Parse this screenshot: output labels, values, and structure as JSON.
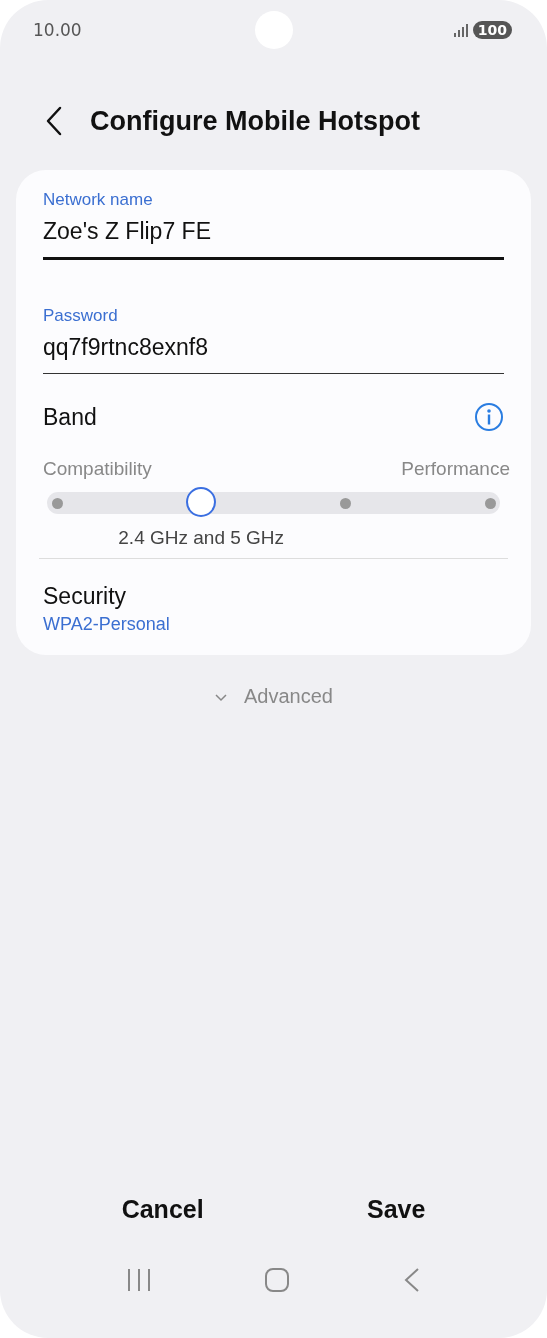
{
  "status_bar": {
    "time": "10.00",
    "battery": "100"
  },
  "header": {
    "title": "Configure Mobile Hotspot"
  },
  "fields": [
    {
      "label": "Network name",
      "value": "Zoe's Z Flip7 FE",
      "focused": true
    },
    {
      "label": "Password",
      "value": "qq7f9rtnc8exnf8",
      "focused": false
    }
  ],
  "band": {
    "label": "Band",
    "min_label": "Compatibility",
    "max_label": "Performance",
    "level": 0.333,
    "reading": "2.4 GHz and 5 GHz"
  },
  "security": {
    "label": "Security",
    "value": "WPA2-Personal"
  },
  "advanced": {
    "label": "Advanced",
    "expanded": false
  },
  "buttons": [
    "Cancel",
    "Save"
  ]
}
